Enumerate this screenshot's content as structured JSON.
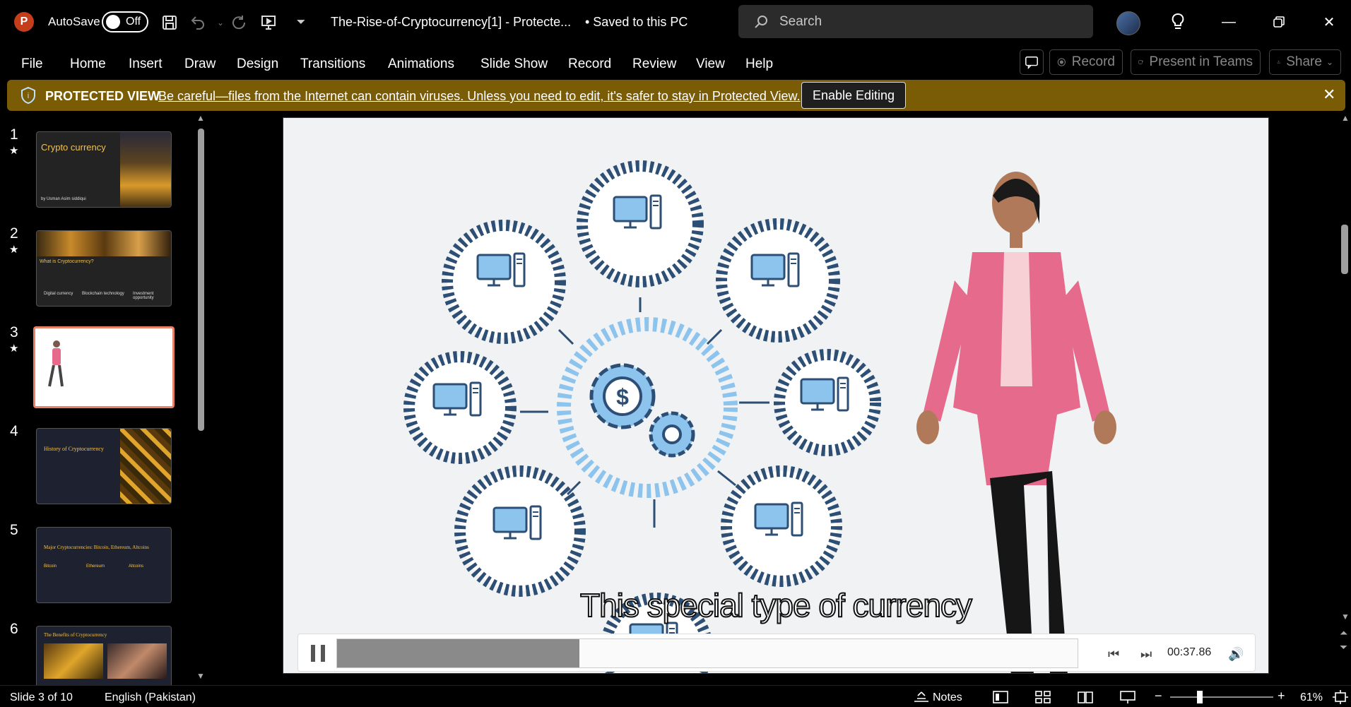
{
  "titlebar": {
    "app_icon": "P",
    "autosave_label": "AutoSave",
    "autosave_state": "Off",
    "doc_title": "The-Rise-of-Cryptocurrency[1]  -  Protecte...",
    "doc_saved": "• Saved to this PC",
    "search_placeholder": "Search"
  },
  "ribbon": {
    "tabs": [
      "File",
      "Home",
      "Insert",
      "Draw",
      "Design",
      "Transitions",
      "Animations",
      "Slide Show",
      "Record",
      "Review",
      "View",
      "Help"
    ],
    "record_label": "Record",
    "present_label": "Present in Teams",
    "share_label": "Share"
  },
  "protected_view": {
    "title": "PROTECTED VIEW",
    "message": "Be careful—files from the Internet can contain viruses. Unless you need to edit, it's safer to stay in Protected View.",
    "enable_label": "Enable Editing"
  },
  "thumbnails": [
    {
      "num": "1",
      "star": "★",
      "title": "Crypto currency",
      "sub": "by Usman Asim siddiqui"
    },
    {
      "num": "2",
      "star": "★",
      "title": "What is Cryptocurrency?",
      "sub1": "Digital currency",
      "sub2": "Blockchain technology",
      "sub3": "Investment opportunity"
    },
    {
      "num": "3",
      "star": "★"
    },
    {
      "num": "4",
      "title": "History of Cryptocurrency"
    },
    {
      "num": "5",
      "title": "Major Cryptocurrencies: Bitcoin, Ethereum, Altcoins",
      "cols": [
        "Bitcoin",
        "Ethereum",
        "Altcoins"
      ]
    },
    {
      "num": "6",
      "title": "The Benefits of Cryptocurrency"
    }
  ],
  "video": {
    "caption": "This special type of currency",
    "timecode": "00:37.86",
    "progress": 0.327
  },
  "status": {
    "slide_info": "Slide 3 of 10",
    "language": "English (Pakistan)",
    "notes_label": "Notes",
    "zoom": "61%"
  },
  "colors": {
    "protected_bar": "#7a5b06",
    "selected_thumb": "#e8806a",
    "accent_blue": "#8cc4ee",
    "ring_dark": "#2d4f75",
    "jacket_pink": "#e66a8c"
  }
}
